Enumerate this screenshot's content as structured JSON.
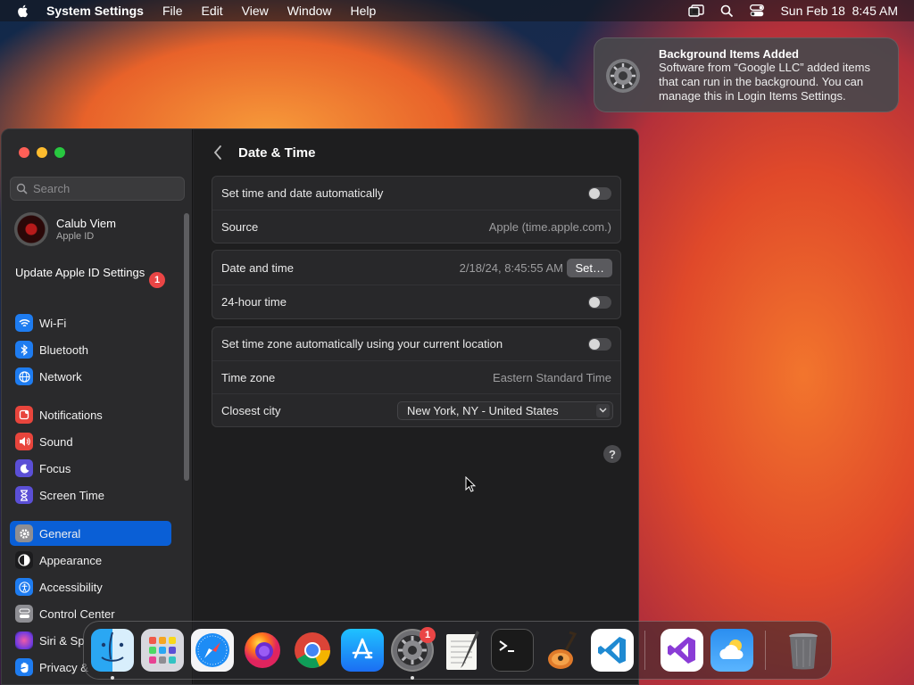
{
  "menubar": {
    "app_name": "System Settings",
    "menus": [
      "File",
      "Edit",
      "View",
      "Window",
      "Help"
    ],
    "clock": "Sun Feb 18  8:45 AM"
  },
  "notification": {
    "title": "Background Items Added",
    "body": "Software from “Google LLC” added items that can run in the background. You can manage this in Login Items Settings."
  },
  "sidebar": {
    "search_placeholder": "Search",
    "profile": {
      "name": "Calub Viem",
      "subtitle": "Apple ID"
    },
    "update_label": "Update Apple ID Settings",
    "update_badge": "1",
    "items": [
      {
        "label": "Wi-Fi",
        "icon": "wifi-icon",
        "color": "#1e7cf0"
      },
      {
        "label": "Bluetooth",
        "icon": "bluetooth-icon",
        "color": "#1e7cf0"
      },
      {
        "label": "Network",
        "icon": "globe-icon",
        "color": "#1e7cf0"
      },
      {
        "label": "Notifications",
        "icon": "bell-icon",
        "color": "#e8453c"
      },
      {
        "label": "Sound",
        "icon": "speaker-icon",
        "color": "#e8453c"
      },
      {
        "label": "Focus",
        "icon": "moon-icon",
        "color": "#5b4fd6"
      },
      {
        "label": "Screen Time",
        "icon": "hourglass-icon",
        "color": "#5b4fd6"
      },
      {
        "label": "General",
        "icon": "gear-icon",
        "color": "#8e8e93",
        "selected": true
      },
      {
        "label": "Appearance",
        "icon": "appearance-icon",
        "color": "#1c1c1e"
      },
      {
        "label": "Accessibility",
        "icon": "accessibility-icon",
        "color": "#1e7cf0"
      },
      {
        "label": "Control Center",
        "icon": "control-center-icon",
        "color": "#8e8e93"
      },
      {
        "label": "Siri & Sp",
        "icon": "siri-icon",
        "color": "#b03ad6"
      },
      {
        "label": "Privacy &",
        "icon": "hand-icon",
        "color": "#1e7cf0"
      }
    ]
  },
  "content": {
    "title": "Date & Time",
    "group1": {
      "auto_label": "Set time and date automatically",
      "auto_enabled": false,
      "source_label": "Source",
      "source_value": "Apple (time.apple.com.)"
    },
    "group2": {
      "datetime_label": "Date and time",
      "datetime_value": "2/18/24, 8:45:55 AM",
      "set_button": "Set…",
      "h24_label": "24-hour time",
      "h24_enabled": false
    },
    "group3": {
      "tz_auto_label": "Set time zone automatically using your current location",
      "tz_auto_enabled": false,
      "tz_label": "Time zone",
      "tz_value": "Eastern Standard Time",
      "city_label": "Closest city",
      "city_value": "New York, NY - United States"
    },
    "help": "?"
  },
  "dock": {
    "apps": [
      "Finder",
      "Launchpad",
      "Safari",
      "Firefox",
      "Chrome",
      "App Store",
      "System Settings",
      "TextEdit",
      "Terminal",
      "GarageBand",
      "Visual Studio Code",
      "Visual Studio",
      "Weather",
      "Trash"
    ],
    "settings_badge": "1"
  }
}
